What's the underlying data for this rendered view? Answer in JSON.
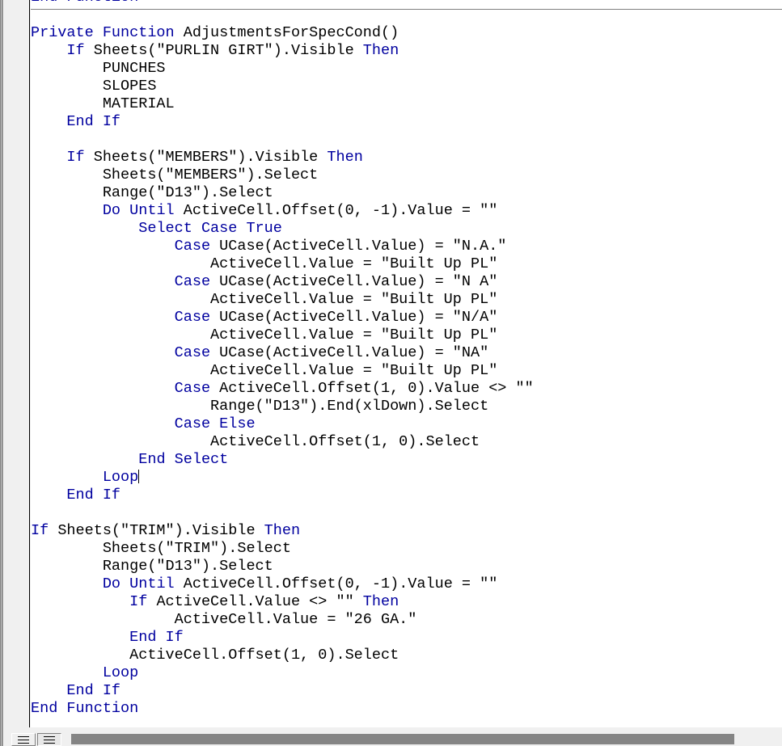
{
  "window": {
    "name": "vba-code-editor-pane",
    "clipped_top_line": "End Function"
  },
  "view_buttons": {
    "procedure_view": {
      "label": "Procedure View",
      "icon": "lines-icon",
      "pressed": false
    },
    "full_module_view": {
      "label": "Full Module View",
      "icon": "lines-icon",
      "pressed": true
    }
  },
  "scrollbar": {
    "orientation": "horizontal",
    "thumb_label": "horizontal-scroll-thumb"
  },
  "colors": {
    "keyword": "#00009f",
    "text": "#000000",
    "background": "#ffffff",
    "chrome": "#f0f0f0",
    "scroll_thumb": "#858585"
  },
  "code": {
    "language": "VBA",
    "procedure_name": "AdjustmentsForSpecCond",
    "lines": [
      [
        [
          "kw",
          "End Function"
        ]
      ],
      [
        [
          "txt",
          ""
        ]
      ],
      [
        [
          "kw",
          "Private Function "
        ],
        [
          "txt",
          "AdjustmentsForSpecCond()"
        ]
      ],
      [
        [
          "txt",
          "    "
        ],
        [
          "kw",
          "If "
        ],
        [
          "txt",
          "Sheets(\"PURLIN GIRT\").Visible "
        ],
        [
          "kw",
          "Then"
        ]
      ],
      [
        [
          "txt",
          "        PUNCHES"
        ]
      ],
      [
        [
          "txt",
          "        SLOPES"
        ]
      ],
      [
        [
          "txt",
          "        MATERIAL"
        ]
      ],
      [
        [
          "txt",
          "    "
        ],
        [
          "kw",
          "End If"
        ]
      ],
      [
        [
          "txt",
          ""
        ]
      ],
      [
        [
          "txt",
          "    "
        ],
        [
          "kw",
          "If "
        ],
        [
          "txt",
          "Sheets(\"MEMBERS\").Visible "
        ],
        [
          "kw",
          "Then"
        ]
      ],
      [
        [
          "txt",
          "        Sheets(\"MEMBERS\").Select"
        ]
      ],
      [
        [
          "txt",
          "        Range(\"D13\").Select"
        ]
      ],
      [
        [
          "txt",
          "        "
        ],
        [
          "kw",
          "Do Until "
        ],
        [
          "txt",
          "ActiveCell.Offset(0, -1).Value = \"\""
        ]
      ],
      [
        [
          "txt",
          "            "
        ],
        [
          "kw",
          "Select Case True"
        ]
      ],
      [
        [
          "txt",
          "                "
        ],
        [
          "kw",
          "Case "
        ],
        [
          "txt",
          "UCase(ActiveCell.Value) = \"N.A.\""
        ]
      ],
      [
        [
          "txt",
          "                    ActiveCell.Value = \"Built Up PL\""
        ]
      ],
      [
        [
          "txt",
          "                "
        ],
        [
          "kw",
          "Case "
        ],
        [
          "txt",
          "UCase(ActiveCell.Value) = \"N A\""
        ]
      ],
      [
        [
          "txt",
          "                    ActiveCell.Value = \"Built Up PL\""
        ]
      ],
      [
        [
          "txt",
          "                "
        ],
        [
          "kw",
          "Case "
        ],
        [
          "txt",
          "UCase(ActiveCell.Value) = \"N/A\""
        ]
      ],
      [
        [
          "txt",
          "                    ActiveCell.Value = \"Built Up PL\""
        ]
      ],
      [
        [
          "txt",
          "                "
        ],
        [
          "kw",
          "Case "
        ],
        [
          "txt",
          "UCase(ActiveCell.Value) = \"NA\""
        ]
      ],
      [
        [
          "txt",
          "                    ActiveCell.Value = \"Built Up PL\""
        ]
      ],
      [
        [
          "txt",
          "                "
        ],
        [
          "kw",
          "Case "
        ],
        [
          "txt",
          "ActiveCell.Offset(1, 0).Value <> \"\""
        ]
      ],
      [
        [
          "txt",
          "                    Range(\"D13\").End(xlDown).Select"
        ]
      ],
      [
        [
          "txt",
          "                "
        ],
        [
          "kw",
          "Case Else"
        ]
      ],
      [
        [
          "txt",
          "                    ActiveCell.Offset(1, 0).Select"
        ]
      ],
      [
        [
          "txt",
          "            "
        ],
        [
          "kw",
          "End Select"
        ]
      ],
      [
        [
          "txt",
          "        "
        ],
        [
          "kw",
          "Loop"
        ],
        [
          "caret",
          ""
        ]
      ],
      [
        [
          "txt",
          "    "
        ],
        [
          "kw",
          "End If"
        ]
      ],
      [
        [
          "txt",
          ""
        ]
      ],
      [
        [
          "kw",
          "If "
        ],
        [
          "txt",
          "Sheets(\"TRIM\").Visible "
        ],
        [
          "kw",
          "Then"
        ]
      ],
      [
        [
          "txt",
          "        Sheets(\"TRIM\").Select"
        ]
      ],
      [
        [
          "txt",
          "        Range(\"D13\").Select"
        ]
      ],
      [
        [
          "txt",
          "        "
        ],
        [
          "kw",
          "Do Until "
        ],
        [
          "txt",
          "ActiveCell.Offset(0, -1).Value = \"\""
        ]
      ],
      [
        [
          "txt",
          "           "
        ],
        [
          "kw",
          "If "
        ],
        [
          "txt",
          "ActiveCell.Value <> \"\" "
        ],
        [
          "kw",
          "Then"
        ]
      ],
      [
        [
          "txt",
          "                ActiveCell.Value = \"26 GA.\""
        ]
      ],
      [
        [
          "txt",
          "           "
        ],
        [
          "kw",
          "End If"
        ]
      ],
      [
        [
          "txt",
          "           ActiveCell.Offset(1, 0).Select"
        ]
      ],
      [
        [
          "txt",
          "        "
        ],
        [
          "kw",
          "Loop"
        ]
      ],
      [
        [
          "txt",
          "    "
        ],
        [
          "kw",
          "End If"
        ]
      ],
      [
        [
          "kw",
          "End Function"
        ]
      ]
    ]
  }
}
